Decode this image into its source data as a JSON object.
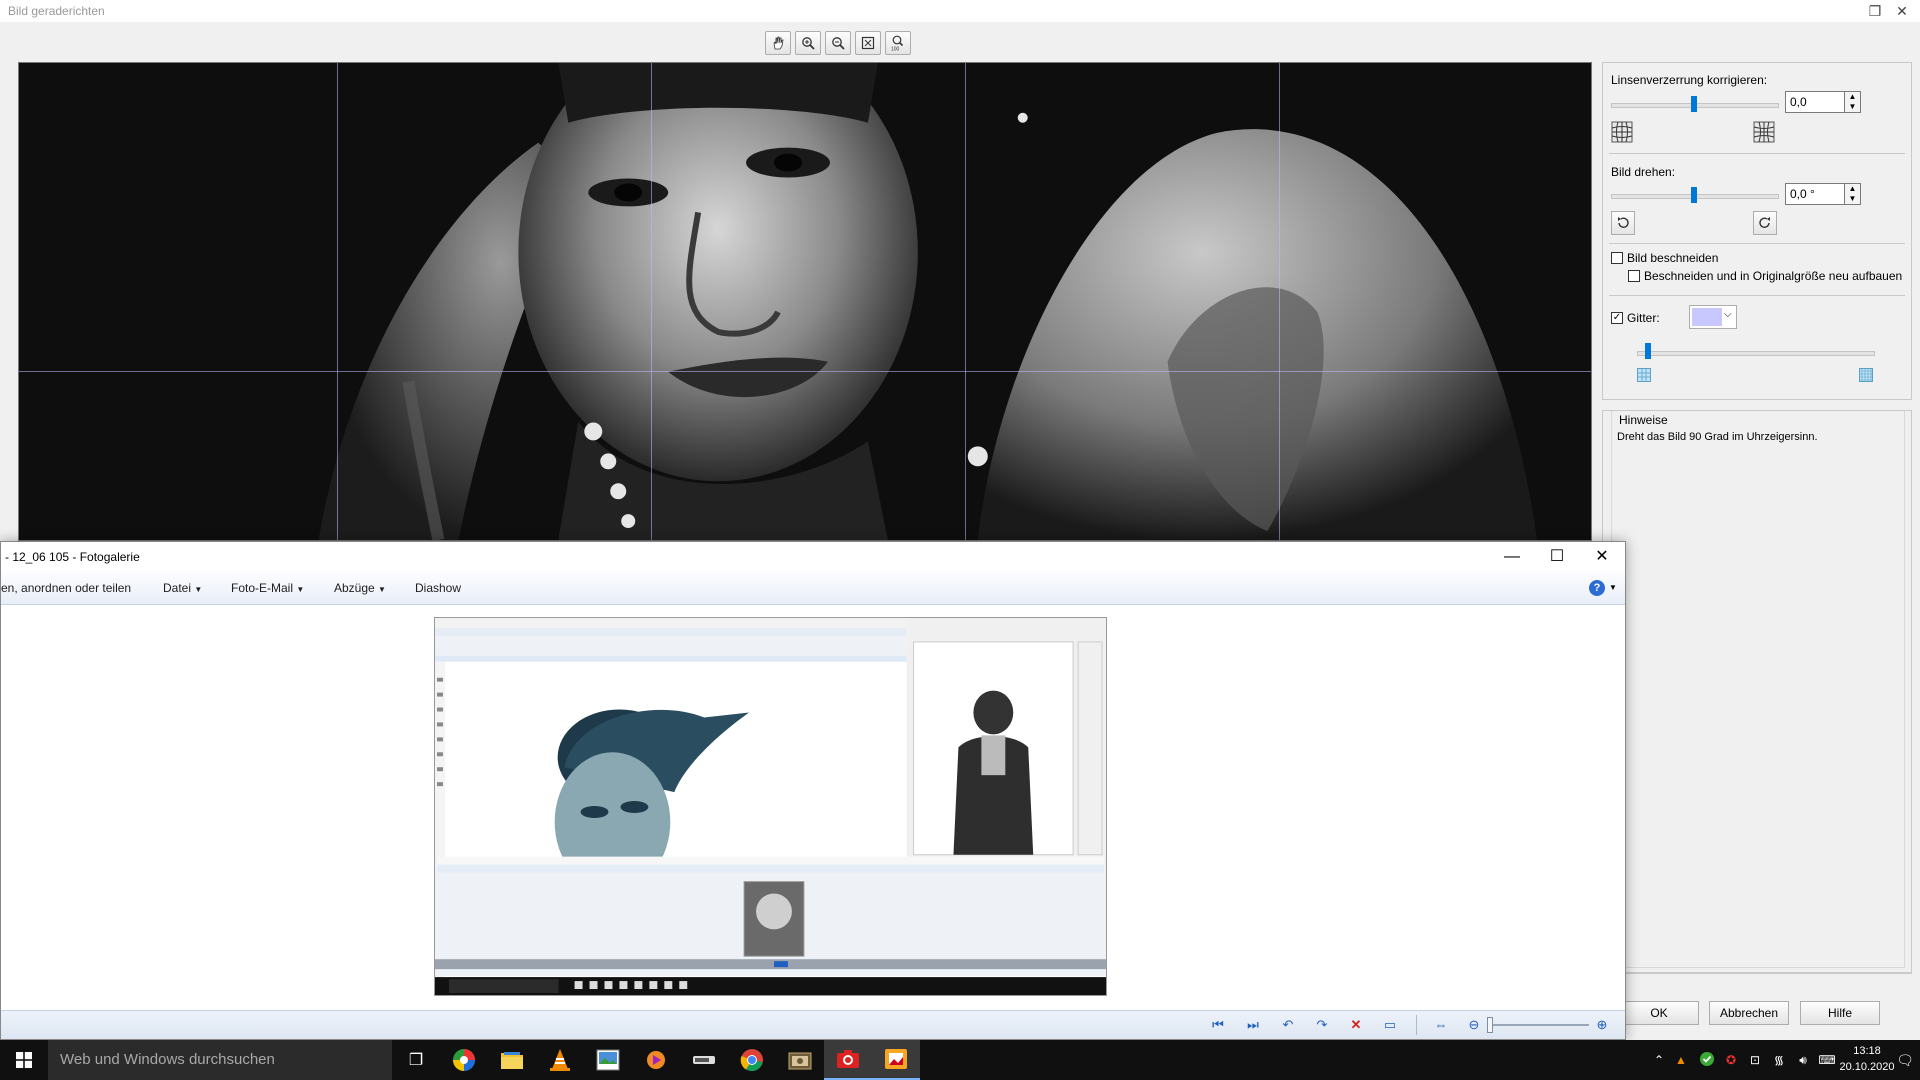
{
  "dialog": {
    "title": "Bild geraderichten",
    "lens": {
      "label": "Linsenverzerrung korrigieren:",
      "value": "0,0"
    },
    "rotate": {
      "label": "Bild drehen:",
      "value": "0,0 °"
    },
    "crop": {
      "label": "Bild beschneiden",
      "sublabel": "Beschneiden und in Originalgröße neu aufbauen"
    },
    "grid": {
      "label": "Gitter:",
      "checked": true,
      "color": "#c8c8ff"
    },
    "hints": {
      "title": "Hinweise",
      "text": "Dreht das Bild 90 Grad im Uhrzeigersinn."
    },
    "buttons": {
      "ok": "OK",
      "cancel": "Abbrechen",
      "help": "Hilfe"
    }
  },
  "gallery": {
    "title": "- 12_06 105 - Fotogalerie",
    "menu": {
      "organize": "en, anordnen oder teilen",
      "file": "Datei",
      "email": "Foto-E-Mail",
      "prints": "Abzüge",
      "slideshow": "Diashow"
    }
  },
  "taskbar": {
    "search_placeholder": "Web und Windows durchsuchen",
    "time": "13:18",
    "date": "20.10.2020"
  },
  "colors": {
    "accent": "#0078d7",
    "taskbar": "#101010",
    "grid": "#c8c8ff"
  }
}
